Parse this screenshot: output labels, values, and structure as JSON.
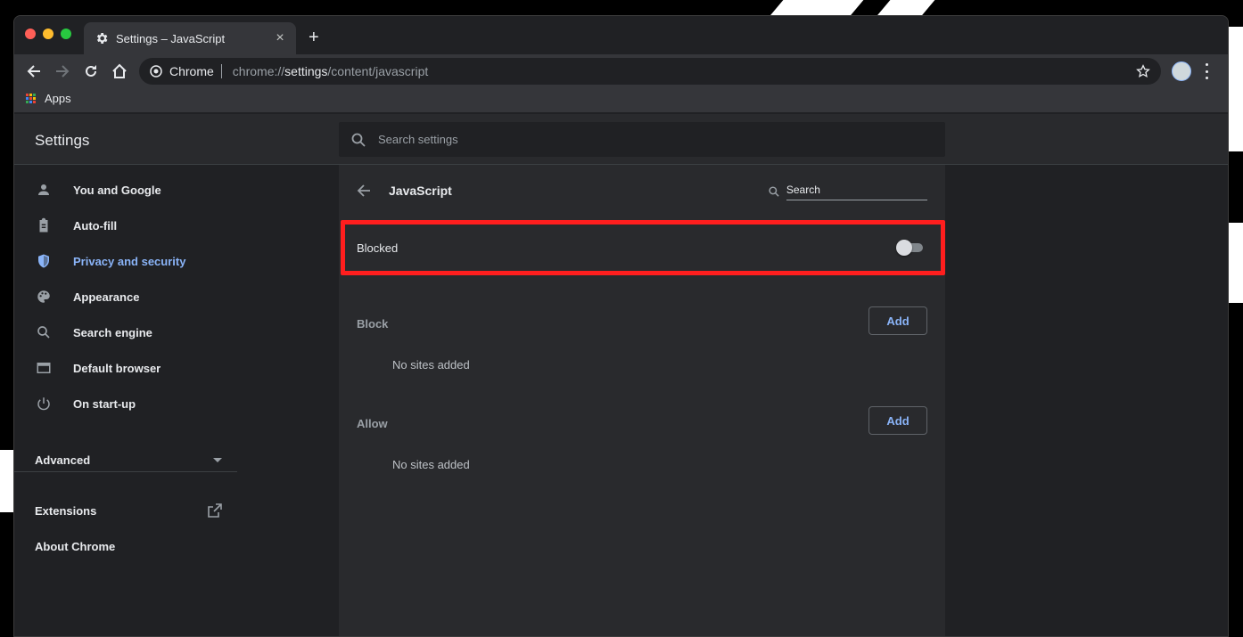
{
  "tab": {
    "title": "Settings – JavaScript",
    "close": "×",
    "new_tab": "+"
  },
  "omnibox": {
    "site_chip": "Chrome",
    "url_prefix": "chrome://",
    "url_host": "settings",
    "url_path": "/content/javascript"
  },
  "bookmarks": {
    "apps_label": "Apps"
  },
  "header": {
    "title": "Settings",
    "search_placeholder": "Search settings"
  },
  "sidebar": {
    "items": [
      {
        "label": "You and Google",
        "icon": "person-icon"
      },
      {
        "label": "Auto-fill",
        "icon": "clipboard-icon"
      },
      {
        "label": "Privacy and security",
        "icon": "shield-icon",
        "active": true
      },
      {
        "label": "Appearance",
        "icon": "palette-icon"
      },
      {
        "label": "Search engine",
        "icon": "search-icon"
      },
      {
        "label": "Default browser",
        "icon": "browser-icon"
      },
      {
        "label": "On start-up",
        "icon": "power-icon"
      }
    ],
    "advanced": "Advanced",
    "extensions": "Extensions",
    "about": "About Chrome"
  },
  "page": {
    "title": "JavaScript",
    "search_placeholder": "Search",
    "toggle_label": "Blocked",
    "toggle_on": false,
    "block": {
      "label": "Block",
      "add": "Add",
      "empty": "No sites added"
    },
    "allow": {
      "label": "Allow",
      "add": "Add",
      "empty": "No sites added"
    }
  },
  "colors": {
    "accent": "#8ab4f8",
    "highlight_border": "#ff1e1e",
    "background": "#202124",
    "card": "#292a2d"
  }
}
